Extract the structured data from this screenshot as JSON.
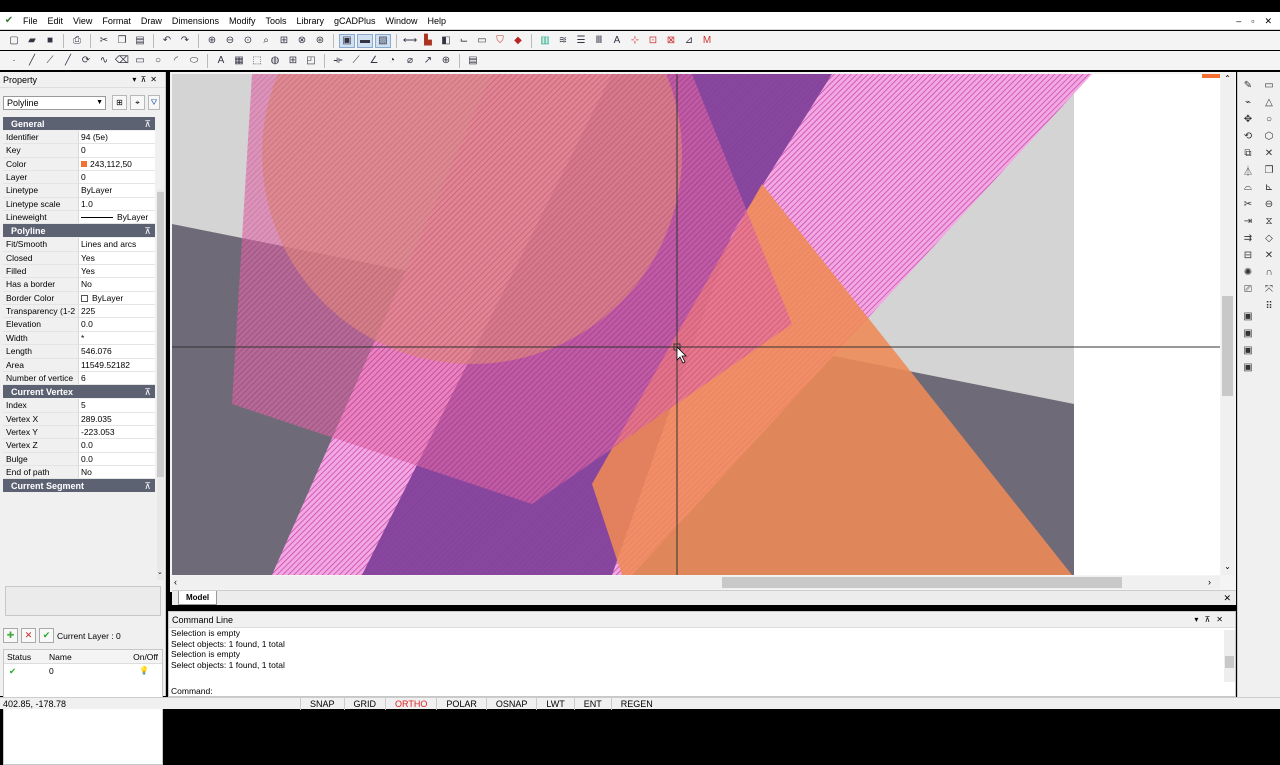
{
  "menu": [
    "File",
    "Edit",
    "View",
    "Format",
    "Draw",
    "Dimensions",
    "Modify",
    "Tools",
    "Library",
    "gCADPlus",
    "Window",
    "Help"
  ],
  "window_controls": {
    "min": "–",
    "restore": "▫",
    "close": "✕"
  },
  "property_panel": {
    "title": "Property",
    "object_type": "Polyline",
    "sections": [
      {
        "title": "General",
        "rows": [
          {
            "k": "Identifier",
            "v": "94 (5e)"
          },
          {
            "k": "Key",
            "v": "0"
          },
          {
            "k": "Color",
            "v": "243,112,50",
            "swatch": "#f37032"
          },
          {
            "k": "Layer",
            "v": "0"
          },
          {
            "k": "Linetype",
            "v": "ByLayer"
          },
          {
            "k": "Linetype scale",
            "v": "1.0"
          },
          {
            "k": "Lineweight",
            "v": "ByLayer",
            "line": true
          }
        ]
      },
      {
        "title": "Polyline",
        "rows": [
          {
            "k": "Fit/Smooth",
            "v": "Lines and arcs"
          },
          {
            "k": "Closed",
            "v": "Yes"
          },
          {
            "k": "Filled",
            "v": "Yes"
          },
          {
            "k": "Has a border",
            "v": "No"
          },
          {
            "k": "Border Color",
            "v": "ByLayer",
            "box": true
          },
          {
            "k": "Transparency (1-2",
            "v": "225"
          },
          {
            "k": "Elevation",
            "v": "0.0"
          },
          {
            "k": "Width",
            "v": "*"
          },
          {
            "k": "Length",
            "v": "546.076"
          },
          {
            "k": "Area",
            "v": "11549.52182"
          },
          {
            "k": "Number of vertice",
            "v": "6"
          }
        ]
      },
      {
        "title": "Current Vertex",
        "rows": [
          {
            "k": "Index",
            "v": "5"
          },
          {
            "k": "Vertex X",
            "v": "289.035"
          },
          {
            "k": "Vertex Y",
            "v": "-223.053"
          },
          {
            "k": "Vertex Z",
            "v": "0.0"
          },
          {
            "k": "Bulge",
            "v": "0.0"
          },
          {
            "k": "End of path",
            "v": "No"
          }
        ]
      },
      {
        "title": "Current Segment",
        "rows": []
      }
    ]
  },
  "layers": {
    "current_label": "Current Layer : 0",
    "headers": [
      "Status",
      "Name",
      "On/Off"
    ],
    "rows": [
      {
        "status": "✔",
        "name": "0",
        "on": "💡"
      }
    ]
  },
  "model_tab": "Model",
  "command": {
    "title": "Command Line",
    "lines": [
      "Selection is empty",
      "Select objects: 1 found,  1 total",
      "Selection is empty",
      "Select objects: 1 found,  1 total"
    ],
    "prompt": "Command:"
  },
  "status": {
    "coords": "402.85,  -178.78",
    "buttons": [
      "SNAP",
      "GRID",
      "ORTHO",
      "POLAR",
      "OSNAP",
      "LWT",
      "ENT",
      "REGEN"
    ],
    "active": "ORTHO",
    "active_color": "#e02020"
  }
}
